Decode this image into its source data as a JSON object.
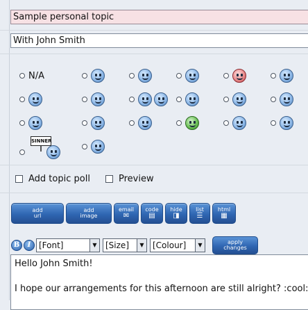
{
  "topic": {
    "value": "Sample personal topic"
  },
  "description": {
    "value": "With John Smith"
  },
  "smileys": {
    "na_label": "N/A",
    "sign_text": "SINNER",
    "icons": [
      "na",
      "smile-icon",
      "wink-icon",
      "grin-icon",
      "angry-red-icon",
      "surprised-icon",
      "tongue-icon",
      "shocked-icon",
      "cool-icon",
      "sad-icon",
      "cheesy-icon",
      "undecided-icon",
      "smiley-icon",
      "kiss-icon",
      "embarrassed-icon",
      "green-sick-icon",
      "rolleyes-icon",
      "lipsrsealed-icon",
      "sinner-icon",
      "angel-icon"
    ]
  },
  "options": {
    "poll_label": "Add topic poll",
    "preview_label": "Preview"
  },
  "toolbar": {
    "buttons": [
      {
        "top": "add",
        "bottom": "url",
        "icon": "link-icon"
      },
      {
        "top": "add",
        "bottom": "image",
        "icon": "image-icon"
      },
      {
        "top": "email",
        "bottom": "",
        "icon": "email-icon"
      },
      {
        "top": "code",
        "bottom": "",
        "icon": "code-icon"
      },
      {
        "top": "hide",
        "bottom": "",
        "icon": "hide-icon"
      },
      {
        "top": "list",
        "bottom": "",
        "icon": "list-icon"
      },
      {
        "top": "html",
        "bottom": "",
        "icon": "html-icon"
      }
    ]
  },
  "format": {
    "bold": "B",
    "italic": "I",
    "font": "[Font]",
    "size": "[Size]",
    "colour": "[Colour]",
    "apply_top": "apply",
    "apply_bottom": "changes"
  },
  "message": {
    "line1": "Hello John Smith!",
    "line2": "",
    "line3": "I hope our arrangements for this afternoon are still alright? :cool:"
  }
}
